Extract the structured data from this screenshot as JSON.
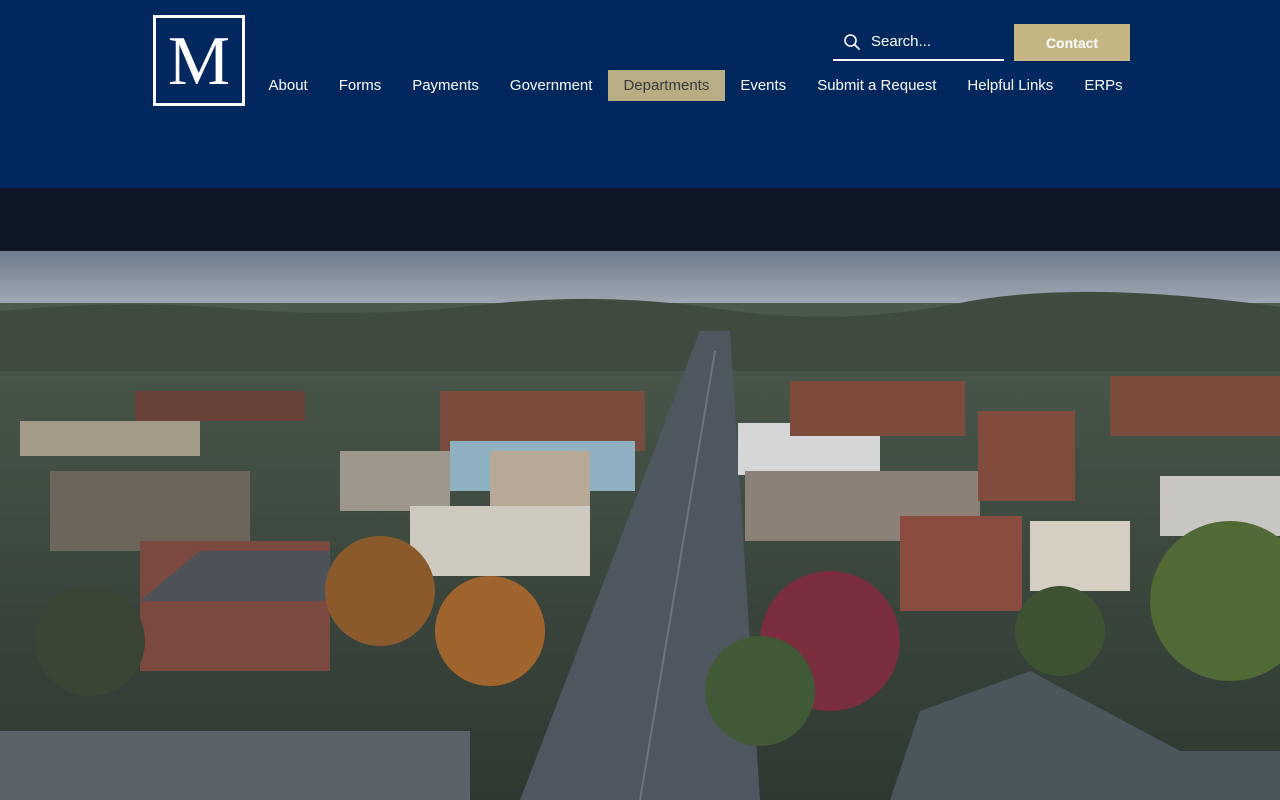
{
  "logo": {
    "letter": "M"
  },
  "search": {
    "placeholder": "Search..."
  },
  "contact": {
    "label": "Contact"
  },
  "nav": {
    "items": [
      {
        "label": "About",
        "active": false
      },
      {
        "label": "Forms",
        "active": false
      },
      {
        "label": "Payments",
        "active": false
      },
      {
        "label": "Government",
        "active": false
      },
      {
        "label": "Departments",
        "active": true
      },
      {
        "label": "Events",
        "active": false
      },
      {
        "label": "Submit a Request",
        "active": false
      },
      {
        "label": "Helpful Links",
        "active": false
      },
      {
        "label": "ERPs",
        "active": false
      }
    ]
  },
  "hero": {
    "image": "aerial-downtown-photo"
  },
  "colors": {
    "header": "#00275e",
    "accent": "#c5b585",
    "active_nav": "#b9ad84"
  }
}
